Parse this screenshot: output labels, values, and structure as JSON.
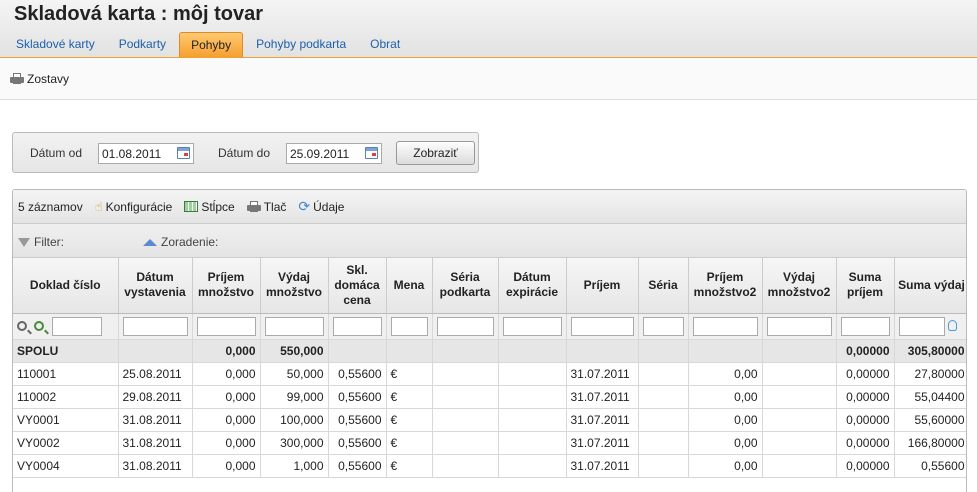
{
  "header": {
    "title": "Skladová karta :  môj tovar",
    "tabs": [
      {
        "label": "Skladové karty"
      },
      {
        "label": "Podkarty"
      },
      {
        "label": "Pohyby"
      },
      {
        "label": "Pohyby podkarta"
      },
      {
        "label": "Obrat"
      }
    ],
    "active_tab": "Pohyby"
  },
  "toolbar": {
    "reports_label": "Zostavy"
  },
  "date_filter": {
    "from_label": "Dátum od",
    "from_value": "01.08.2011",
    "to_label": "Dátum do",
    "to_value": "25.09.2011",
    "show_button": "Zobraziť"
  },
  "grid": {
    "record_count": "5 záznamov",
    "config_label": "Konfigurácie",
    "columns_label": "Stĺpce",
    "print_label": "Tlač",
    "data_label": "Údaje",
    "filter_label": "Filter:",
    "sort_label": "Zoradenie:",
    "headers": [
      "Doklad číslo",
      "Dátum vystavenia",
      "Príjem množstvo",
      "Výdaj množstvo",
      "Skl. domáca cena",
      "Mena",
      "Séria podkarta",
      "Dátum expirácie",
      "Príjem",
      "Séria",
      "Príjem množstvo2",
      "Výdaj množstvo2",
      "Suma príjem",
      "Suma výdaj"
    ],
    "sum_row": [
      "SPOLU",
      "",
      "0,000",
      "550,000",
      "",
      "",
      "",
      "",
      "",
      "",
      "",
      "",
      "0,00000",
      "305,80000"
    ],
    "rows": [
      [
        "110001",
        "25.08.2011",
        "0,000",
        "50,000",
        "0,55600",
        "€",
        "",
        "",
        "31.07.2011",
        "",
        "0,00",
        "",
        "0,00000",
        "27,80000"
      ],
      [
        "110002",
        "29.08.2011",
        "0,000",
        "99,000",
        "0,55600",
        "€",
        "",
        "",
        "31.07.2011",
        "",
        "0,00",
        "",
        "0,00000",
        "55,04400"
      ],
      [
        "VY0001",
        "31.08.2011",
        "0,000",
        "100,000",
        "0,55600",
        "€",
        "",
        "",
        "31.07.2011",
        "",
        "0,00",
        "",
        "0,00000",
        "55,60000"
      ],
      [
        "VY0002",
        "31.08.2011",
        "0,000",
        "300,000",
        "0,55600",
        "€",
        "",
        "",
        "31.07.2011",
        "",
        "0,00",
        "",
        "0,00000",
        "166,80000"
      ],
      [
        "VY0004",
        "31.08.2011",
        "0,000",
        "1,000",
        "0,55600",
        "€",
        "",
        "",
        "31.07.2011",
        "",
        "0,00",
        "",
        "0,00000",
        "0,55600"
      ]
    ]
  },
  "colors": {
    "accent": "#f5a030",
    "link": "#1c5fae",
    "sum_row": "#e6e6e6"
  }
}
